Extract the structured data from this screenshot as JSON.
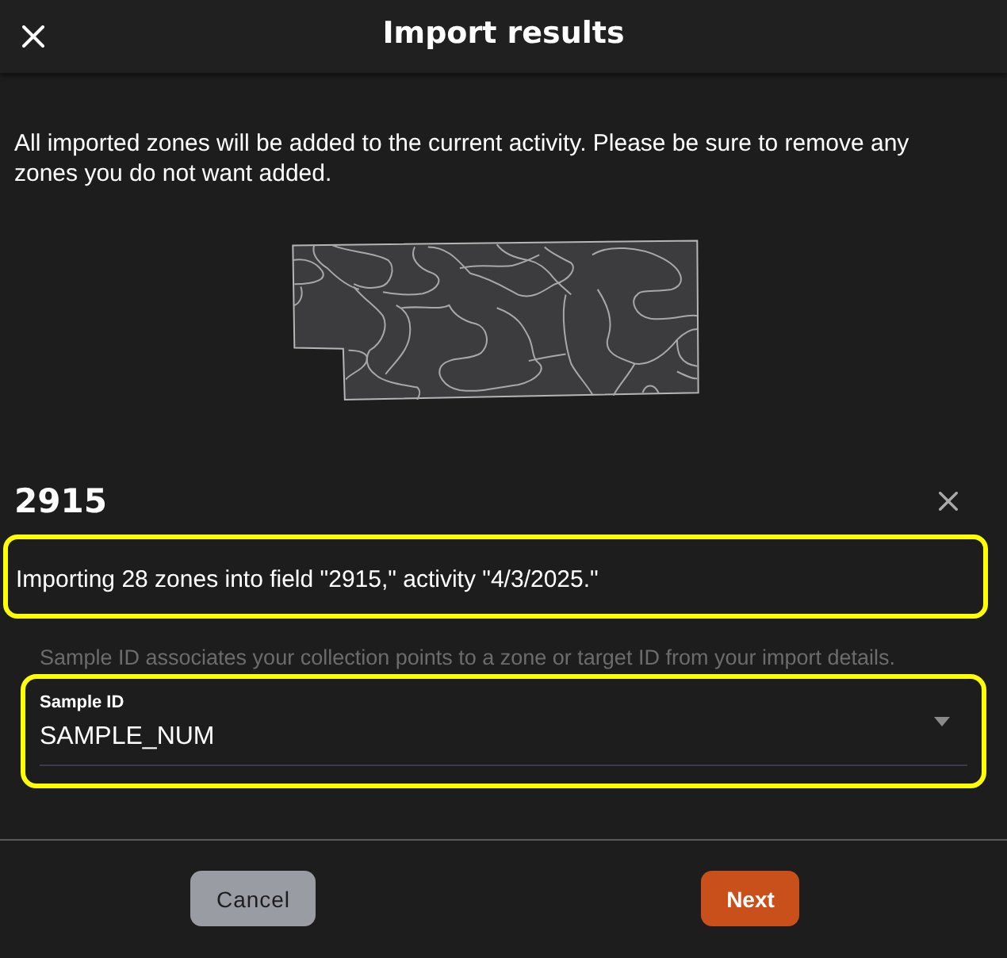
{
  "header": {
    "title": "Import results"
  },
  "intro": "All imported zones will be added to the current activity. Please be sure to remove any zones you do not want added.",
  "field_card": {
    "title": "2915",
    "message": {
      "text": "Importing 28 zones into field \"2915,\" activity \"4/3/2025.\"",
      "highlighted": true
    },
    "helper_text": "Sample ID associates your collection points to a zone or target ID from your import details.",
    "sample_id_select": {
      "label": "Sample ID",
      "value": "SAMPLE_NUM",
      "highlighted": true
    }
  },
  "buttons": [
    {
      "label": "Cancel",
      "kind": "secondary"
    },
    {
      "label": "Next",
      "kind": "primary"
    }
  ]
}
